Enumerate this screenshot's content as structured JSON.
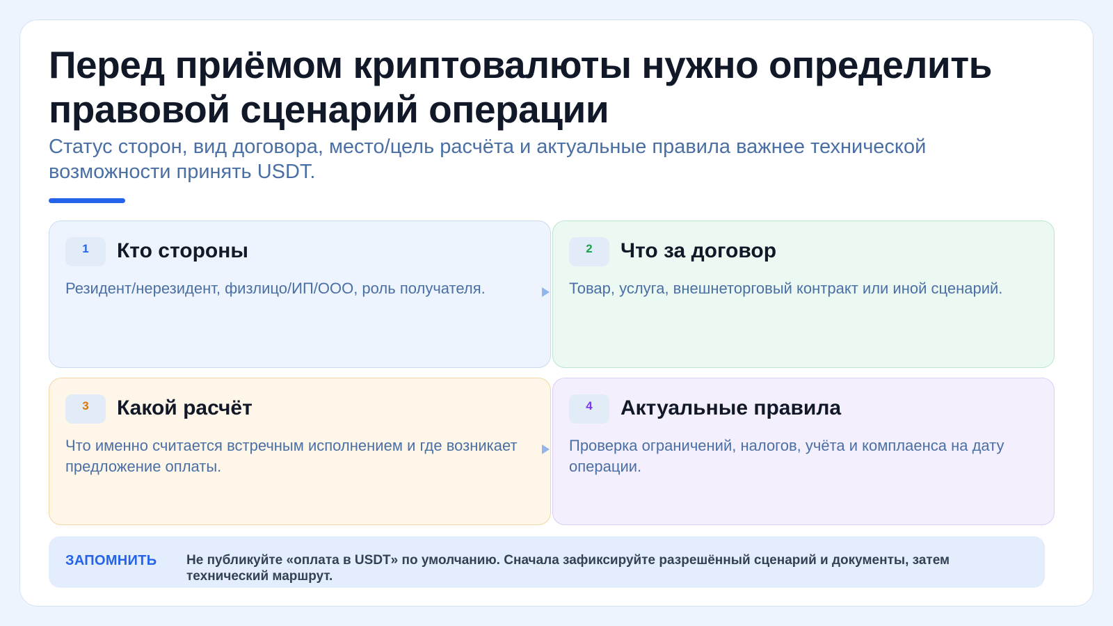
{
  "header": {
    "title": "Перед приёмом криптовалюты нужно определить правовой сценарий операции",
    "subtitle": "Статус сторон, вид договора, место/цель расчёта и актуальные правила важнее технической возможности принять USDT."
  },
  "cards": [
    {
      "number": "1",
      "title": "Кто стороны",
      "text": "Резидент/нерезидент, физлицо/ИП/ООО, роль получателя.",
      "accent": "#2563eb"
    },
    {
      "number": "2",
      "title": "Что за договор",
      "text": "Товар, услуга, внешнеторговый контракт или иной сценарий.",
      "accent": "#16a34a"
    },
    {
      "number": "3",
      "title": "Какой расчёт",
      "text": "Что именно считается встречным исполнением и где возникает предложение оплаты.",
      "accent": "#d97706"
    },
    {
      "number": "4",
      "title": "Актуальные правила",
      "text": "Проверка ограничений, налогов, учёта и комплаенса на дату операции.",
      "accent": "#7c3aed"
    }
  ],
  "note": {
    "label": "ЗАПОМНИТЬ",
    "text": "Не публикуйте «оплата в USDT» по умолчанию. Сначала зафиксируйте разрешённый сценарий и документы, затем технический маршрут."
  },
  "icons": [
    "arrow-right-icon",
    "arrow-right-icon"
  ],
  "colors": {
    "accent": "#2563eb",
    "title": "#111827",
    "subtitle": "#4a6fa5",
    "background": "#eef4fd"
  }
}
